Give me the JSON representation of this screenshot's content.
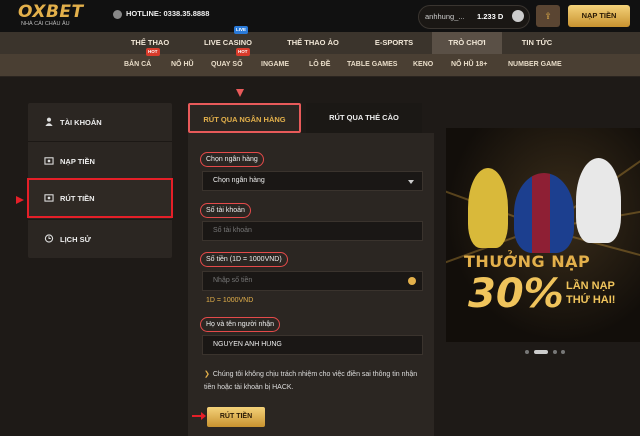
{
  "header": {
    "logo_text": "OXBET",
    "logo_tagline": "NHÀ CÁI CHÂU ÂU",
    "hotline": "HOTLINE: 0338.35.8888",
    "username": "anhhung_...",
    "balance": "1.233 D",
    "deposit_label": "NẠP TIỀN"
  },
  "nav_main": [
    {
      "label": "THỂ THAO"
    },
    {
      "label": "LIVE CASINO",
      "badge": "LIVE"
    },
    {
      "label": "THỂ THAO ẢO"
    },
    {
      "label": "E-SPORTS"
    },
    {
      "label": "TRÒ CHƠI",
      "active": true
    },
    {
      "label": "TIN TỨC"
    }
  ],
  "nav_sub": [
    {
      "label": "BẮN CÁ",
      "badge": "HOT"
    },
    {
      "label": "NỔ HŨ"
    },
    {
      "label": "QUAY SỐ",
      "badge": "HOT"
    },
    {
      "label": "INGAME"
    },
    {
      "label": "LÔ ĐỀ"
    },
    {
      "label": "TABLE GAMES"
    },
    {
      "label": "KENO"
    },
    {
      "label": "NỔ HŨ 18+"
    },
    {
      "label": "NUMBER GAME"
    }
  ],
  "sidebar": {
    "items": [
      {
        "label": "TÀI KHOẢN",
        "icon": "user-icon"
      },
      {
        "label": "NẠP TIỀN",
        "icon": "deposit-icon"
      },
      {
        "label": "RÚT TIỀN",
        "icon": "withdraw-icon",
        "active": true
      },
      {
        "label": "LỊCH SỬ",
        "icon": "history-icon"
      }
    ]
  },
  "tabs": {
    "bank": "RÚT QUA NGÂN HÀNG",
    "card": "RÚT QUA THẺ CÀO"
  },
  "form": {
    "bank_label": "Chọn ngân hàng",
    "bank_value": "Chọn ngân hàng",
    "account_label": "Số tài khoản",
    "account_placeholder": "Số tài khoản",
    "amount_label": "Số tiền (1D = 1000VND)",
    "amount_placeholder": "Nhập số tiền",
    "rate_text": "1D = 1000VND",
    "name_label": "Họ và tên người nhận",
    "name_value": "NGUYEN ANH HUNG",
    "note": "Chúng tôi không chịu trách nhiệm cho việc điền sai thông tin nhận tiền hoặc tài khoản bị HACK.",
    "submit_label": "RÚT TIỀN"
  },
  "promo": {
    "title": "THƯỞNG NẠP",
    "percent": "30%",
    "line1": "LẦN NẠP",
    "line2": "THỨ HAI!"
  },
  "carousel": {
    "dots": 4,
    "active_index": 1
  },
  "colors": {
    "accent": "#e3b04b",
    "highlight": "#e51f28"
  }
}
